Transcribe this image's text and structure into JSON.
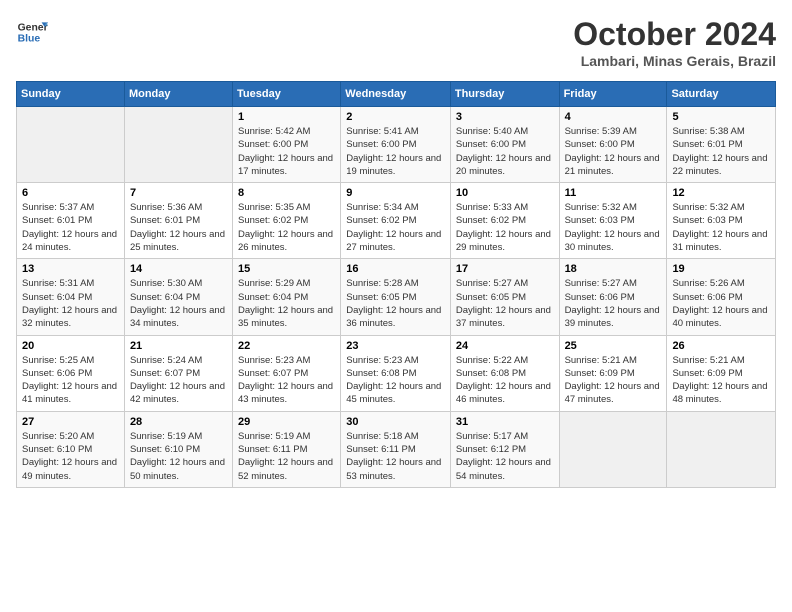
{
  "header": {
    "logo_line1": "General",
    "logo_line2": "Blue",
    "month_title": "October 2024",
    "location": "Lambari, Minas Gerais, Brazil"
  },
  "days_of_week": [
    "Sunday",
    "Monday",
    "Tuesday",
    "Wednesday",
    "Thursday",
    "Friday",
    "Saturday"
  ],
  "weeks": [
    [
      {
        "day": "",
        "info": ""
      },
      {
        "day": "",
        "info": ""
      },
      {
        "day": "1",
        "info": "Sunrise: 5:42 AM\nSunset: 6:00 PM\nDaylight: 12 hours and 17 minutes."
      },
      {
        "day": "2",
        "info": "Sunrise: 5:41 AM\nSunset: 6:00 PM\nDaylight: 12 hours and 19 minutes."
      },
      {
        "day": "3",
        "info": "Sunrise: 5:40 AM\nSunset: 6:00 PM\nDaylight: 12 hours and 20 minutes."
      },
      {
        "day": "4",
        "info": "Sunrise: 5:39 AM\nSunset: 6:00 PM\nDaylight: 12 hours and 21 minutes."
      },
      {
        "day": "5",
        "info": "Sunrise: 5:38 AM\nSunset: 6:01 PM\nDaylight: 12 hours and 22 minutes."
      }
    ],
    [
      {
        "day": "6",
        "info": "Sunrise: 5:37 AM\nSunset: 6:01 PM\nDaylight: 12 hours and 24 minutes."
      },
      {
        "day": "7",
        "info": "Sunrise: 5:36 AM\nSunset: 6:01 PM\nDaylight: 12 hours and 25 minutes."
      },
      {
        "day": "8",
        "info": "Sunrise: 5:35 AM\nSunset: 6:02 PM\nDaylight: 12 hours and 26 minutes."
      },
      {
        "day": "9",
        "info": "Sunrise: 5:34 AM\nSunset: 6:02 PM\nDaylight: 12 hours and 27 minutes."
      },
      {
        "day": "10",
        "info": "Sunrise: 5:33 AM\nSunset: 6:02 PM\nDaylight: 12 hours and 29 minutes."
      },
      {
        "day": "11",
        "info": "Sunrise: 5:32 AM\nSunset: 6:03 PM\nDaylight: 12 hours and 30 minutes."
      },
      {
        "day": "12",
        "info": "Sunrise: 5:32 AM\nSunset: 6:03 PM\nDaylight: 12 hours and 31 minutes."
      }
    ],
    [
      {
        "day": "13",
        "info": "Sunrise: 5:31 AM\nSunset: 6:04 PM\nDaylight: 12 hours and 32 minutes."
      },
      {
        "day": "14",
        "info": "Sunrise: 5:30 AM\nSunset: 6:04 PM\nDaylight: 12 hours and 34 minutes."
      },
      {
        "day": "15",
        "info": "Sunrise: 5:29 AM\nSunset: 6:04 PM\nDaylight: 12 hours and 35 minutes."
      },
      {
        "day": "16",
        "info": "Sunrise: 5:28 AM\nSunset: 6:05 PM\nDaylight: 12 hours and 36 minutes."
      },
      {
        "day": "17",
        "info": "Sunrise: 5:27 AM\nSunset: 6:05 PM\nDaylight: 12 hours and 37 minutes."
      },
      {
        "day": "18",
        "info": "Sunrise: 5:27 AM\nSunset: 6:06 PM\nDaylight: 12 hours and 39 minutes."
      },
      {
        "day": "19",
        "info": "Sunrise: 5:26 AM\nSunset: 6:06 PM\nDaylight: 12 hours and 40 minutes."
      }
    ],
    [
      {
        "day": "20",
        "info": "Sunrise: 5:25 AM\nSunset: 6:06 PM\nDaylight: 12 hours and 41 minutes."
      },
      {
        "day": "21",
        "info": "Sunrise: 5:24 AM\nSunset: 6:07 PM\nDaylight: 12 hours and 42 minutes."
      },
      {
        "day": "22",
        "info": "Sunrise: 5:23 AM\nSunset: 6:07 PM\nDaylight: 12 hours and 43 minutes."
      },
      {
        "day": "23",
        "info": "Sunrise: 5:23 AM\nSunset: 6:08 PM\nDaylight: 12 hours and 45 minutes."
      },
      {
        "day": "24",
        "info": "Sunrise: 5:22 AM\nSunset: 6:08 PM\nDaylight: 12 hours and 46 minutes."
      },
      {
        "day": "25",
        "info": "Sunrise: 5:21 AM\nSunset: 6:09 PM\nDaylight: 12 hours and 47 minutes."
      },
      {
        "day": "26",
        "info": "Sunrise: 5:21 AM\nSunset: 6:09 PM\nDaylight: 12 hours and 48 minutes."
      }
    ],
    [
      {
        "day": "27",
        "info": "Sunrise: 5:20 AM\nSunset: 6:10 PM\nDaylight: 12 hours and 49 minutes."
      },
      {
        "day": "28",
        "info": "Sunrise: 5:19 AM\nSunset: 6:10 PM\nDaylight: 12 hours and 50 minutes."
      },
      {
        "day": "29",
        "info": "Sunrise: 5:19 AM\nSunset: 6:11 PM\nDaylight: 12 hours and 52 minutes."
      },
      {
        "day": "30",
        "info": "Sunrise: 5:18 AM\nSunset: 6:11 PM\nDaylight: 12 hours and 53 minutes."
      },
      {
        "day": "31",
        "info": "Sunrise: 5:17 AM\nSunset: 6:12 PM\nDaylight: 12 hours and 54 minutes."
      },
      {
        "day": "",
        "info": ""
      },
      {
        "day": "",
        "info": ""
      }
    ]
  ]
}
